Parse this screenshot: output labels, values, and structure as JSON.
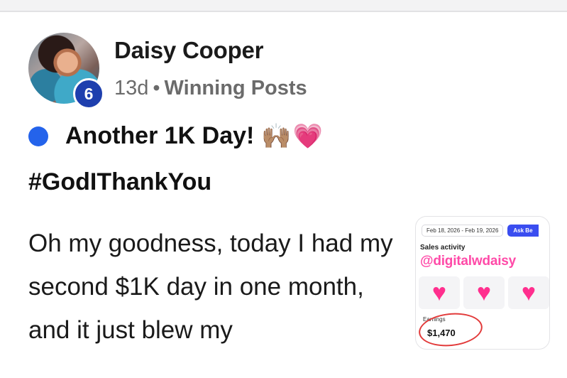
{
  "post": {
    "author": "Daisy Cooper",
    "level_badge": "6",
    "time_ago": "13d",
    "separator": "•",
    "group": "Winning Posts",
    "title": "Another 1K Day!",
    "title_emoji_hands": "🙌🏽",
    "title_emoji_heart": "💗",
    "hashtag": "#GodIThankYou",
    "body": "Oh my goodness, today I had my second $1K day in one month, and it just blew my"
  },
  "thumbnail": {
    "date_range": "Feb 18, 2026 - Feb 19, 2026",
    "ask_button": "Ask Be",
    "sales_label": "Sales activity",
    "handle": "@digitalwdaisy",
    "earnings_label": "Earnings",
    "earnings_value": "$1,470",
    "heart_glyph": "♥"
  },
  "colors": {
    "blue_dot": "#2463eb",
    "badge": "#1e3fae",
    "handle_pink": "#ff4aa8",
    "circle_red": "#e23a3a"
  }
}
